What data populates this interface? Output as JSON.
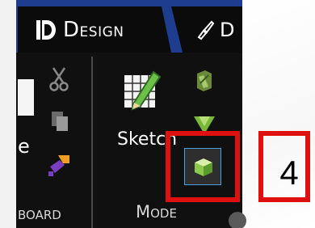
{
  "ribbon": {
    "tabs": [
      {
        "label": "Design",
        "selected": true
      },
      {
        "label": "D",
        "selected": false
      }
    ],
    "groups": [
      {
        "label": "board"
      },
      {
        "label": "Mode"
      }
    ],
    "buttons": {
      "clipboard_partial_label": "e",
      "sketch_label": "Sketch"
    }
  },
  "annotation": {
    "label": "4",
    "color": "#e01010"
  },
  "colors": {
    "tab_bar": "#1e3d8f",
    "ribbon_bg": "#101010",
    "active_border": "#4aa0e0"
  }
}
